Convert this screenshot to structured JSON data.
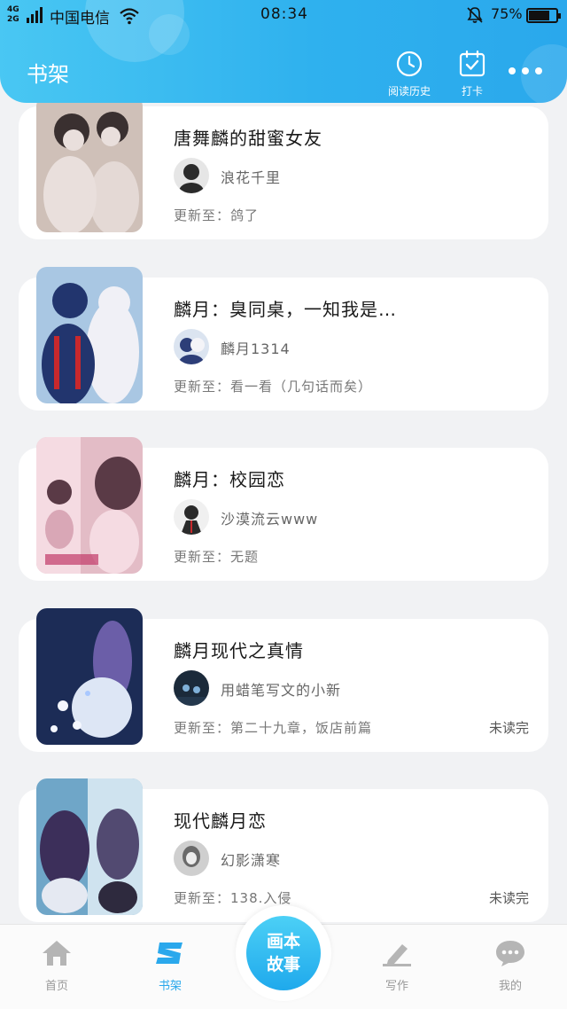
{
  "status_bar": {
    "network_top": "4G",
    "network_bottom": "2G",
    "carrier": "中国电信",
    "time": "08:34",
    "battery_percent": "75%",
    "battery_level": 0.75
  },
  "header": {
    "title": "书架",
    "history_label": "阅读历史",
    "checkin_label": "打卡"
  },
  "books": [
    {
      "title": "唐舞麟的甜蜜女友",
      "author": "浪花千里",
      "update": "更新至：鸽了",
      "unread": "",
      "colors": {
        "cover_bg": "#cfc0b8",
        "cover_a": "#3a3030",
        "cover_b": "#e9dfdc",
        "avatar_bg": "#e6e6e6",
        "avatar_fg": "#2b2b2b"
      }
    },
    {
      "title": "麟月：臭同桌，一知我是…",
      "author": "麟月1314",
      "update": "更新至：看一看（几句话而矣）",
      "unread": "",
      "colors": {
        "cover_bg": "#a9c7e3",
        "cover_a": "#22356e",
        "cover_b": "#f0f0f6",
        "avatar_bg": "#dbe4f0",
        "avatar_fg": "#2d3e78"
      }
    },
    {
      "title": "麟月：校园恋",
      "author": "沙漠流云www",
      "update": "更新至：无题",
      "unread": "",
      "colors": {
        "cover_bg": "#e3bcc6",
        "cover_a": "#5a3a46",
        "cover_b": "#f5dbe2",
        "avatar_bg": "#f0f0f0",
        "avatar_fg": "#2a2a2a"
      }
    },
    {
      "title": "麟月现代之真情",
      "author": "用蜡笔写文的小新",
      "update": "更新至：第二十九章，饭店前篇",
      "unread": "未读完",
      "colors": {
        "cover_bg": "#1c2c56",
        "cover_a": "#6b5ea8",
        "cover_b": "#dde6f5",
        "avatar_bg": "#1b2a3a",
        "avatar_fg": "#7fb0d8"
      }
    },
    {
      "title": "现代麟月恋",
      "author": "幻影潇寒",
      "update": "更新至：138.入侵",
      "unread": "未读完",
      "colors": {
        "cover_bg": "#6fa6c8",
        "cover_a": "#3c2f5a",
        "cover_b": "#cfe3ef",
        "avatar_bg": "#cfcfcf",
        "avatar_fg": "#6a6a6a"
      }
    }
  ],
  "bottom_nav": {
    "home": "首页",
    "shelf": "书架",
    "center_line1": "画本",
    "center_line2": "故事",
    "write": "写作",
    "mine": "我的"
  },
  "theme": {
    "accent": "#2aa8ec",
    "inactive_icon": "#b5b5b5"
  },
  "icons": {
    "history": "clock-icon",
    "checkin": "calendar-check-icon",
    "more": "more-dots-icon",
    "home": "home-icon",
    "shelf": "shelf-s-icon",
    "write": "pencil-icon",
    "mine": "chat-bubble-icon"
  }
}
